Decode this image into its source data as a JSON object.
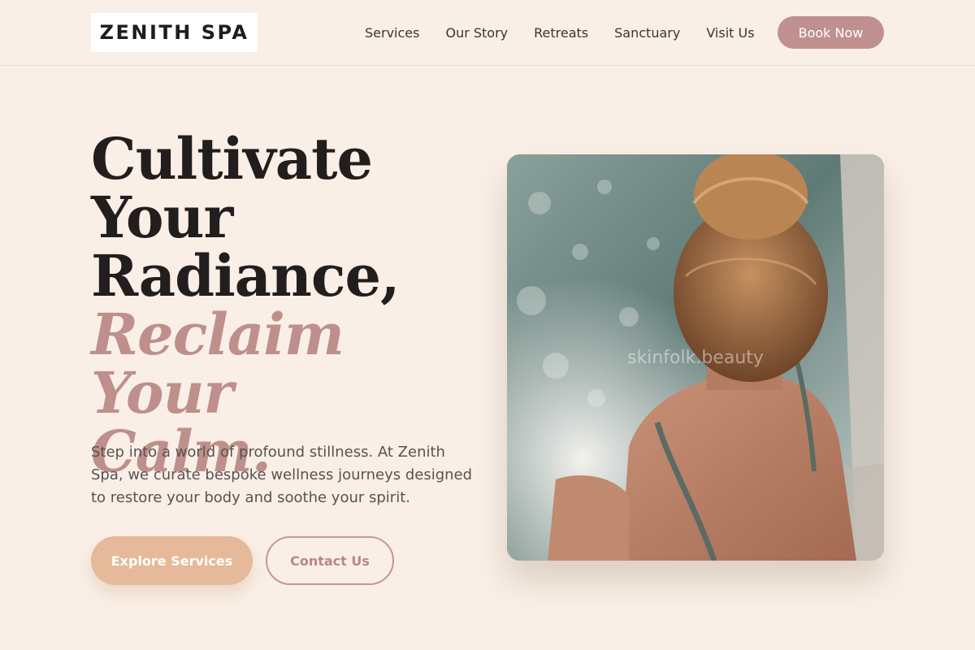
{
  "header": {
    "logo": "ZENITH SPA",
    "nav": [
      "Services",
      "Our Story",
      "Retreats",
      "Sanctuary",
      "Visit Us"
    ],
    "cta": "Book Now"
  },
  "hero": {
    "headline_line1": "Cultivate",
    "headline_line2": "Your",
    "headline_line3": "Radiance,",
    "accent_line1": "Reclaim Your",
    "accent_line2": "Calm.",
    "lead": "Step into a world of profound stillness. At Zenith Spa, we curate bespoke wellness journeys designed to restore your body and soothe your spirit.",
    "primary_button": "Explore Services",
    "secondary_button": "Contact Us",
    "image": {
      "subject": "woman with hair bun relaxing in a bubbling hot tub, seen from behind",
      "watermark": "skinfolk.beauty"
    }
  },
  "colors": {
    "background": "#f9efe6",
    "accent_rose": "#c0908f",
    "accent_peach": "#e5b999",
    "text_dark": "#221e1d"
  }
}
